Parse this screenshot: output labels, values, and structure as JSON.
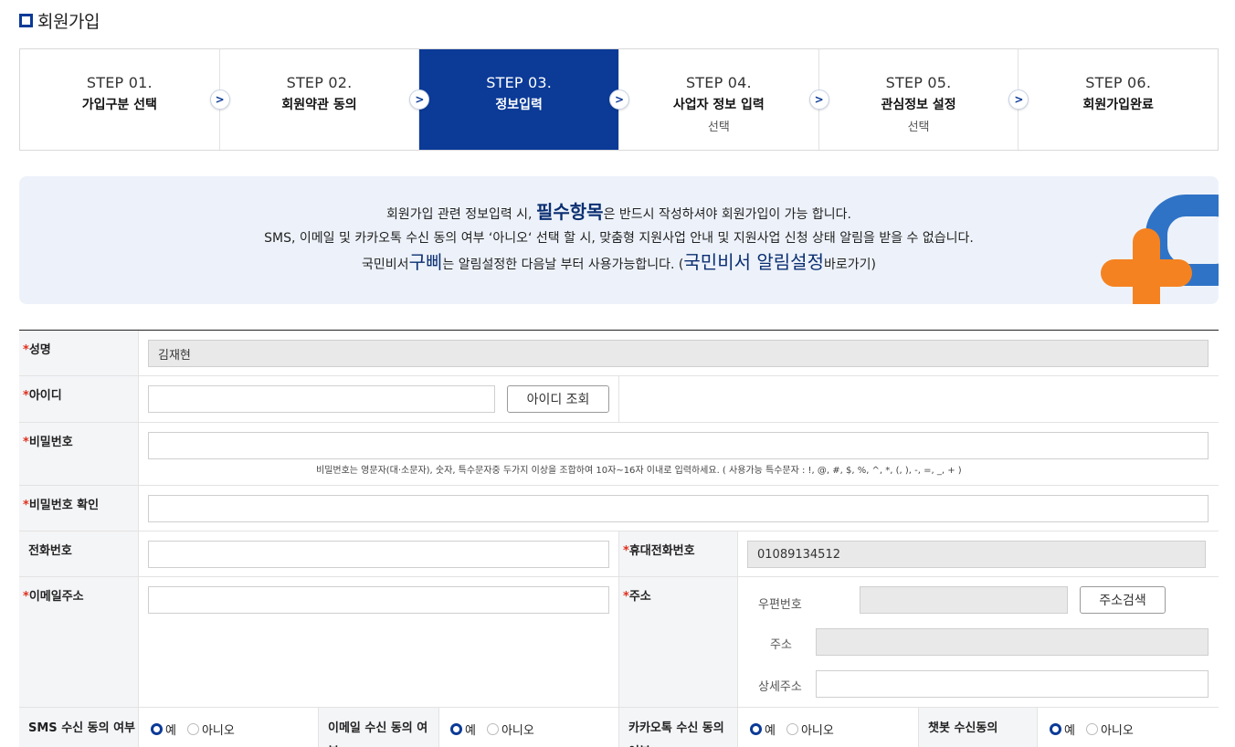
{
  "page": {
    "title": "회원가입"
  },
  "steps": [
    {
      "no": "STEP 01.",
      "name": "가입구분 선택",
      "sub": ""
    },
    {
      "no": "STEP 02.",
      "name": "회원약관 동의",
      "sub": ""
    },
    {
      "no": "STEP 03.",
      "name": "정보입력",
      "sub": ""
    },
    {
      "no": "STEP 04.",
      "name": "사업자 정보 입력",
      "sub": "선택"
    },
    {
      "no": "STEP 05.",
      "name": "관심정보 설정",
      "sub": "선택"
    },
    {
      "no": "STEP 06.",
      "name": "회원가입완료",
      "sub": ""
    }
  ],
  "active_step": 3,
  "notice": {
    "l1a": "회원가입 관련 정보입력 시, ",
    "l1b": "필수항목",
    "l1c": "은 반드시 작성하셔야 회원가입이 가능 합니다.",
    "l2": "SMS, 이메일 및 카카오톡 수신 동의 여부 ‘아니오‘ 선택 할 시, 맞춤형 지원사업 안내 및 지원사업 신청 상태 알림을 받을 수 없습니다.",
    "l3a": "국민비서",
    "l3b": "구삐",
    "l3c": "는 알림설정한 다음날 부터 사용가능합니다. (",
    "l3d": "국민비서 알림설정",
    "l3e": "바로가기)"
  },
  "form": {
    "req_mark": "*",
    "name_label": "성명",
    "name_value": "김재현",
    "id_label": "아이디",
    "id_check_btn": "아이디 조회",
    "pw_label": "비밀번호",
    "pw_hint": "비밀번호는 영문자(대·소문자), 숫자, 특수문자중 두가지 이상을 조합하여 10자~16자 이내로 입력하세요. ( 사용가능 특수문자 : !, @, #, $, %, ^, *, (, ), -, =, _, + )",
    "pw_confirm_label": "비밀번호 확인",
    "phone_label": "전화번호",
    "mobile_label": "휴대전화번호",
    "mobile_value": "01089134512",
    "email_label": "이메일주소",
    "address_label": "주소",
    "zip_label": "우편번호",
    "zip_btn": "주소검색",
    "addr_label": "주소",
    "addr_detail_label": "상세주소",
    "sms_label": "SMS 수신 동의 여부",
    "email_agree_label": "이메일 수신 동의 여부",
    "kakao_label": "카카오톡 수신 동의 여부",
    "chatbot_label": "챗봇 수신동의",
    "yes": "예",
    "no": "아니오"
  }
}
